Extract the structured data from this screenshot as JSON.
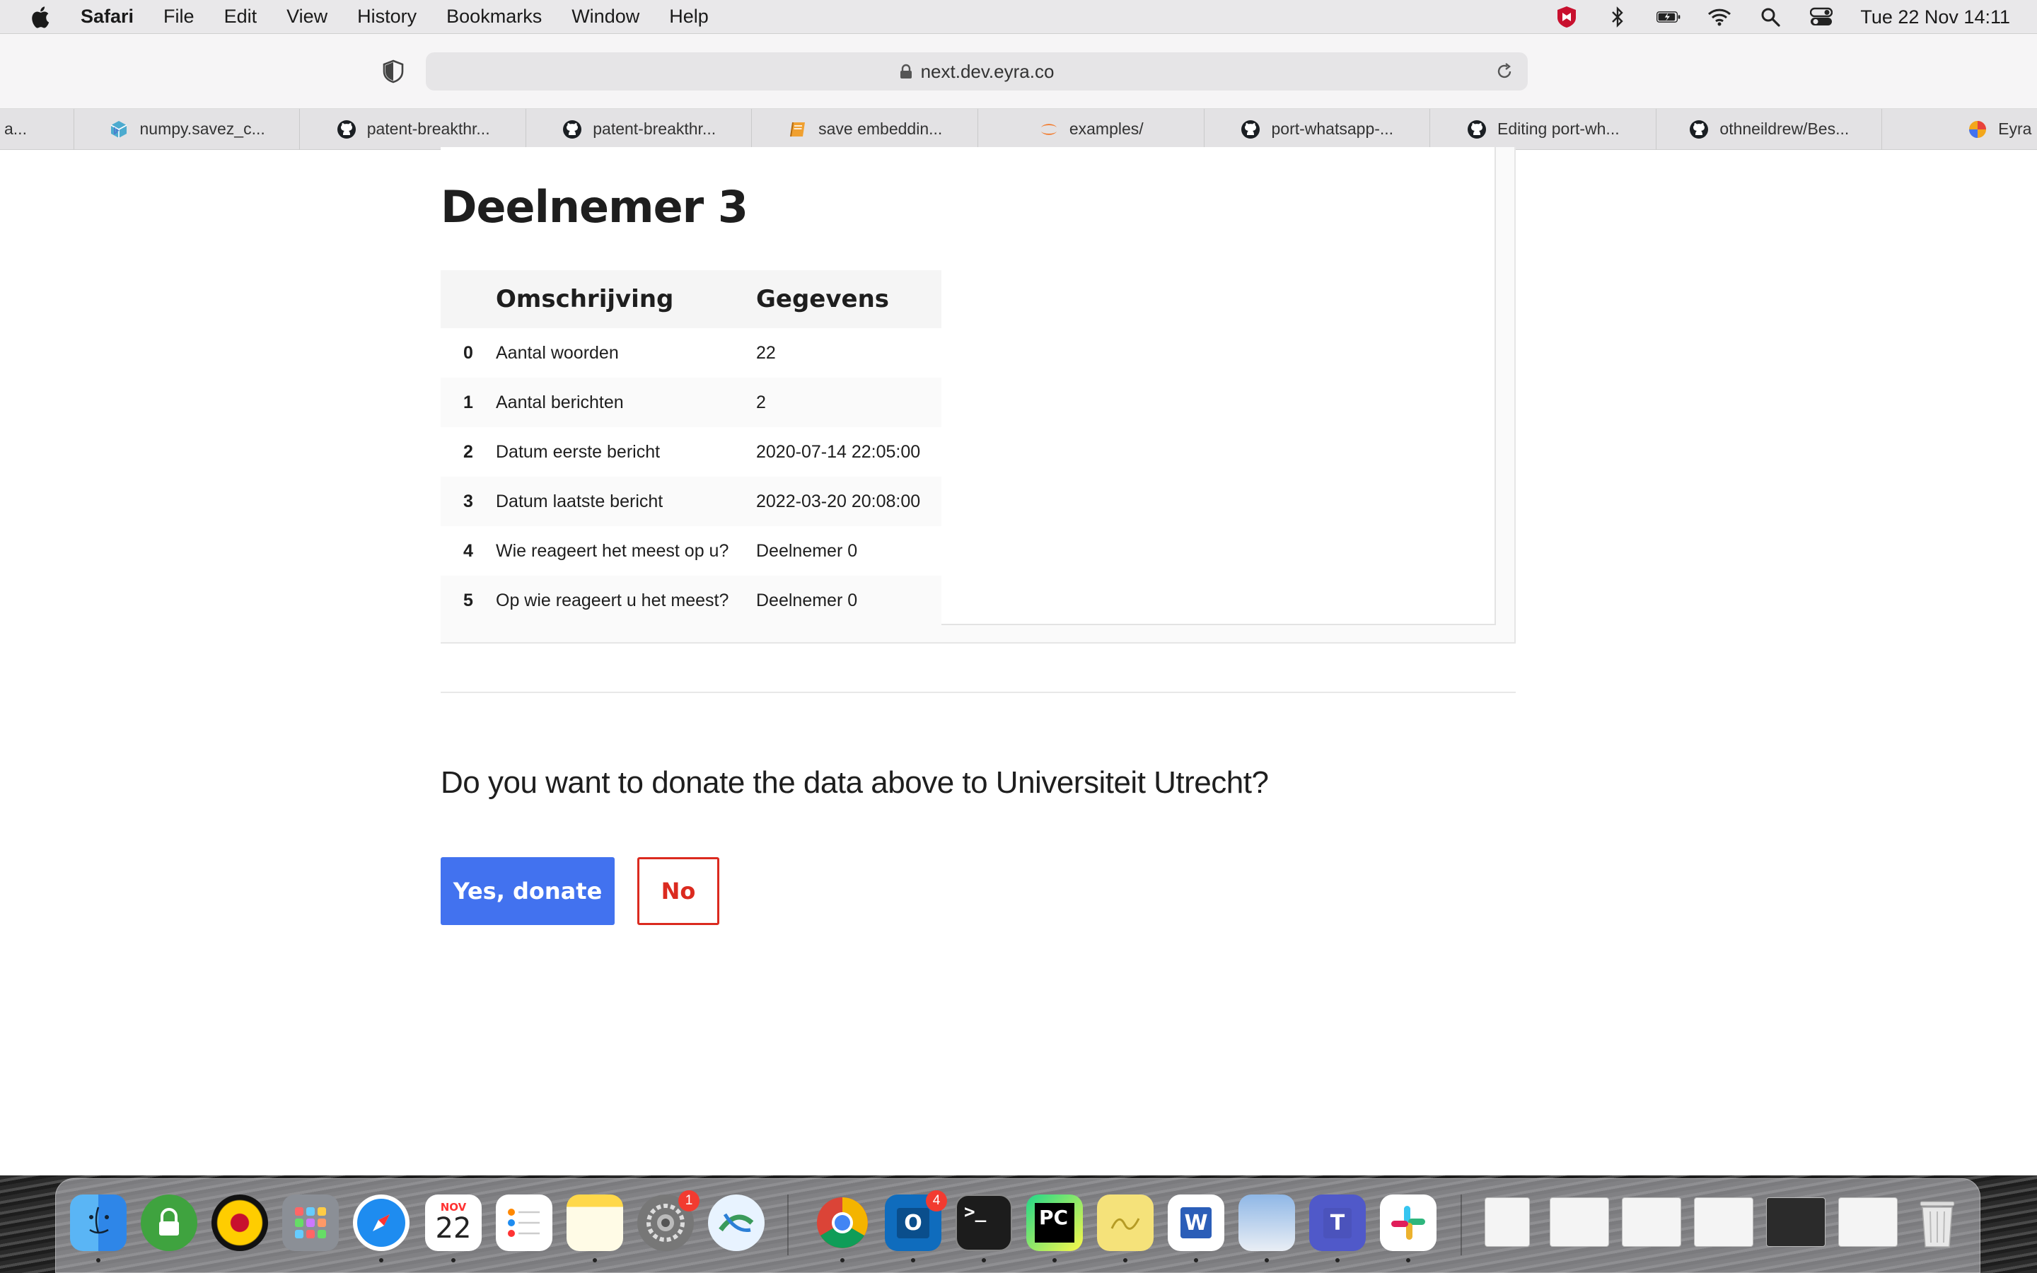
{
  "menubar": {
    "app": "Safari",
    "items": [
      "File",
      "Edit",
      "View",
      "History",
      "Bookmarks",
      "Window",
      "Help"
    ],
    "clock": "Tue 22 Nov  14:11"
  },
  "toolbar": {
    "url": "next.dev.eyra.co"
  },
  "tabs": [
    {
      "title": "a...",
      "icon": "blank-icon"
    },
    {
      "title": "numpy.savez_c...",
      "icon": "numpy-icon"
    },
    {
      "title": "patent-breakthr...",
      "icon": "github-icon"
    },
    {
      "title": "patent-breakthr...",
      "icon": "github-icon"
    },
    {
      "title": "save embeddin...",
      "icon": "book-icon"
    },
    {
      "title": "examples/",
      "icon": "jupyter-icon"
    },
    {
      "title": "port-whatsapp-...",
      "icon": "github-icon"
    },
    {
      "title": "Editing port-wh...",
      "icon": "github-icon"
    },
    {
      "title": "othneildrew/Bes...",
      "icon": "github-icon"
    },
    {
      "title": "Eyra",
      "icon": "eyra-icon"
    }
  ],
  "main": {
    "participant_title": "Deelnemer 3",
    "table": {
      "headers": [
        "",
        "Omschrijving",
        "Gegevens"
      ],
      "rows": [
        {
          "idx": "0",
          "desc": "Aantal woorden",
          "value": "22"
        },
        {
          "idx": "1",
          "desc": "Aantal berichten",
          "value": "2"
        },
        {
          "idx": "2",
          "desc": "Datum eerste bericht",
          "value": "2020-07-14 22:05:00"
        },
        {
          "idx": "3",
          "desc": "Datum laatste bericht",
          "value": "2022-03-20 20:08:00"
        },
        {
          "idx": "4",
          "desc": "Wie reageert het meest op u?",
          "value": "Deelnemer 0"
        },
        {
          "idx": "5",
          "desc": "Op wie reageert u het meest?",
          "value": "Deelnemer 0"
        }
      ]
    },
    "question": "Do you want to donate the data above to Universiteit Utrecht?",
    "yes_label": "Yes, donate",
    "no_label": "No"
  },
  "dock": {
    "calendar_month": "NOV",
    "calendar_day": "22",
    "settings_badge": "1",
    "outlook_badge": "4",
    "apps": [
      "finder-icon",
      "lock-icon",
      "university-icon",
      "launchpad-icon",
      "safari-icon",
      "calendar-icon",
      "reminders-icon",
      "notes-icon",
      "system-preferences-icon",
      "maps-icon",
      "chrome-icon",
      "outlook-icon",
      "terminal-icon",
      "pycharm-icon",
      "stickies-icon",
      "word-icon",
      "preview-icon",
      "teams-icon",
      "slack-icon",
      "trash-icon"
    ]
  },
  "colors": {
    "primary": "#4272ef",
    "danger": "#db2a1f",
    "menubar": "#e9e8ea"
  }
}
